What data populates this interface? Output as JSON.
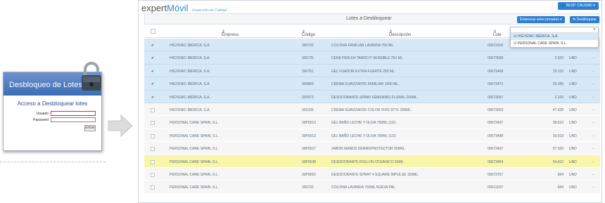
{
  "login": {
    "header": "Desbloqueo de Lotes",
    "title": "Acceso a Desbloquear lotes",
    "user_label": "Usuario",
    "password_label": "Password",
    "enter_label": "Entrar"
  },
  "app": {
    "brand_prefix": "expert",
    "brand_accent": "Móvil",
    "tagline": "Inspección de Calidad",
    "user_button": "RESP. CALIDAD",
    "panel_title": "Lotes a Desbloquear",
    "companies_button": "Empresas seleccionadas",
    "unlock_button": "Desbloquear"
  },
  "dropdown": {
    "items": [
      {
        "label": "HIGYENIC IBÉRICA, S.A.",
        "checked": true
      },
      {
        "label": "PERSONAL CARE SPAIN, S.L.",
        "checked": true
      }
    ]
  },
  "table": {
    "headers": {
      "empresa": "Empresa",
      "codigo": "Código",
      "descripcion": "Descripción",
      "lote": "Lote"
    },
    "rows": [
      {
        "check": "✔",
        "empresa": "HIGYENIC IBÉRICA, S.A.",
        "codigo": "300702",
        "descripcion": "COLONIA FAMILIAR LAVANDA 750 ML.",
        "lote": "00013206",
        "cantidad": "",
        "unidad": ""
      },
      {
        "check": "✔",
        "empresa": "HIGYENIC IBÉRICA, S.A.",
        "codigo": "300725",
        "descripcion": "CERA FRIA EN TARRO P SENSIBLE 250 ML.",
        "lote": "00073598",
        "cantidad": "2.520",
        "unidad": "UND"
      },
      {
        "check": "✔",
        "empresa": "HIGYENIC IBÉRICA, S.A.",
        "codigo": "300751",
        "descripcion": "GEL FIJADOR EXTRA FUERTE 250 ML.",
        "lote": "00073468",
        "cantidad": "25.110",
        "unidad": "UND"
      },
      {
        "check": "✔",
        "empresa": "HIGYENIC IBÉRICA, S.A.",
        "codigo": "300869",
        "descripcion": "CREMA SUAVIZANTE FAMILIAR 1000 ML.",
        "lote": "00073472",
        "cantidad": "29.280",
        "unidad": "UND"
      },
      {
        "check": "✔",
        "empresa": "HIGYENIC IBÉRICA, S.A.",
        "codigo": "300973",
        "descripcion": "DESODORANTE SPRAY FEMENINO FLORAL 150ML.",
        "lote": "00073597",
        "cantidad": "2.100",
        "unidad": "UND"
      },
      {
        "check": "",
        "empresa": "HIGYENIC IBÉRICA, S.A.",
        "codigo": "301039",
        "descripcion": "CREMA SUAVIZANTE COLOR VIVO STYL 300ML.",
        "lote": "00073503",
        "cantidad": "47.628",
        "unidad": "UND"
      },
      {
        "check": "",
        "empresa": "PERSONAL CARE SPAIN, S.L.",
        "codigo": "30P0013",
        "descripcion": "GEL BAÑO LECHE Y OLIVA 750ML (1/2)",
        "lote": "00073497",
        "cantidad": "38.610",
        "unidad": "UND"
      },
      {
        "check": "",
        "empresa": "PERSONAL CARE SPAIN, S.L.",
        "codigo": "30P0013",
        "descripcion": "GEL BAÑO LECHE Y OLIVA 750ML (1/2)",
        "lote": "00073488",
        "cantidad": "39.018",
        "unidad": "UND"
      },
      {
        "check": "",
        "empresa": "PERSONAL CARE SPAIN, S.L.",
        "codigo": "30P0027",
        "descripcion": "JABON MANOS DERMOPROTECTOR 500ML.",
        "lote": "00073497",
        "cantidad": "57.330",
        "unidad": "UND"
      },
      {
        "check": "",
        "empresa": "PERSONAL CARE SPAIN, S.L.",
        "codigo": "30P0038",
        "descripcion": "DESODORANTE ROLLON OCEANICO 50ML.",
        "lote": "00073454",
        "cantidad": "54.432",
        "unidad": "UND"
      },
      {
        "check": "",
        "empresa": "PERSONAL CARE SPAIN, S.L.",
        "codigo": "30P0062",
        "descripcion": "DESODORANTE SPRAY 4 SQUARE IMPULSE 150ML.",
        "lote": "00073707",
        "cantidad": "684",
        "unidad": "UND"
      },
      {
        "check": "",
        "empresa": "PERSONAL CARE SPAIN, S.L.",
        "codigo": "300702",
        "descripcion": "COLONIA LAVANDA 750ML NUEVA PAL",
        "lote": "00013207",
        "cantidad": "684",
        "unidad": "UND"
      }
    ]
  }
}
